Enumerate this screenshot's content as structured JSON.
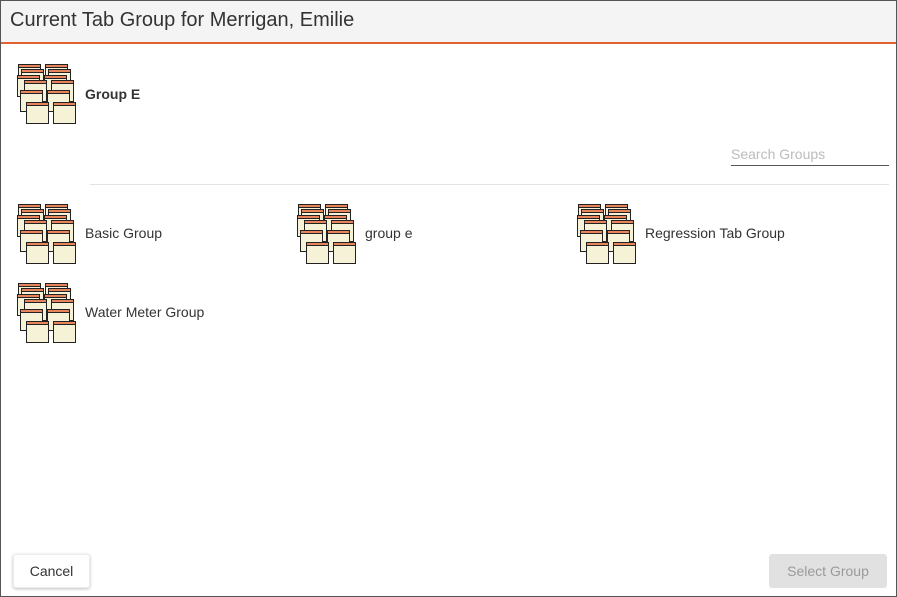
{
  "dialog": {
    "title": "Current Tab Group for Merrigan, Emilie",
    "accent_color": "#e0622e"
  },
  "current_group": {
    "name": "Group E",
    "icon": "tab-group-icon"
  },
  "search": {
    "placeholder": "Search Groups",
    "value": ""
  },
  "groups": [
    {
      "name": "Basic Group",
      "icon": "tab-group-icon"
    },
    {
      "name": "group e",
      "icon": "tab-group-icon"
    },
    {
      "name": "Regression Tab Group",
      "icon": "tab-group-icon"
    },
    {
      "name": "Water Meter Group",
      "icon": "tab-group-icon"
    }
  ],
  "buttons": {
    "cancel": "Cancel",
    "select": "Select Group"
  }
}
